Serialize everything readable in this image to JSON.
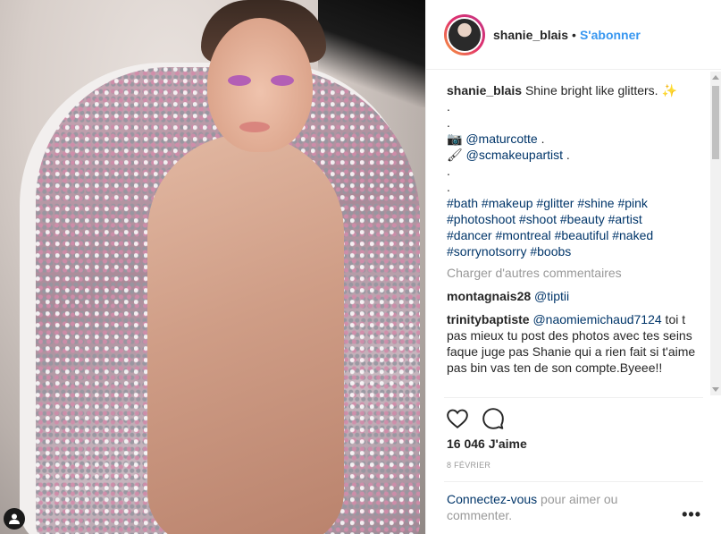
{
  "post": {
    "username": "shanie_blais",
    "separator": "•",
    "follow_label": "S'abonner",
    "caption": {
      "user": "shanie_blais",
      "text": "Shine bright like glitters. ✨",
      "dot1": ".",
      "dot2": ".",
      "camera_emoji": "📷",
      "credit1": "@maturcotte",
      "credit1_tail": " .",
      "brush_emoji": "🖌",
      "credit2": "@scmakeupartist",
      "credit2_tail": " .",
      "dot3": ".",
      "dot4": ".",
      "hashtags": [
        "#bath #makeup #glitter #shine #pink",
        "#photoshoot #shoot #beauty #artist",
        "#dancer #montreal #beautiful #naked",
        "#sorrynotsorry #boobs"
      ]
    },
    "load_more": "Charger d'autres commentaires",
    "comments": [
      {
        "user": "montagnais28",
        "mention": "@tiptii",
        "text": ""
      },
      {
        "user": "trinitybaptiste",
        "mention": "@naomiemichaud7124",
        "text": " toi t pas mieux tu post des photos avec tes seins faque juge pas Shanie qui a rien fait si t'aime pas bin vas ten de son compte.Byeee!!"
      }
    ],
    "likes": "16 046 J'aime",
    "date": "8 FÉVRIER",
    "login_link": "Connectez-vous",
    "login_text": " pour aimer ou commenter.",
    "options": "•••"
  },
  "icons": {
    "like": "heart-outline-icon",
    "comment": "speech-bubble-icon",
    "user_tag": "user-silhouette-icon"
  },
  "colors": {
    "link": "#3897f0",
    "mention": "#003569",
    "muted": "#999999",
    "text": "#262626"
  }
}
